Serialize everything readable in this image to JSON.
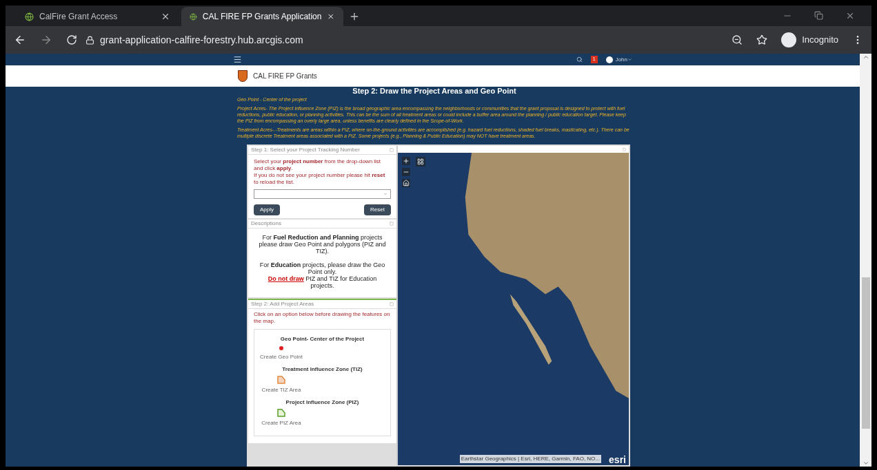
{
  "browser": {
    "tabs": [
      {
        "title": "CalFire Grant Access",
        "selected": false
      },
      {
        "title": "CAL FIRE FP Grants Application",
        "selected": true
      }
    ],
    "url": "grant-application-calfire-forestry.hub.arcgis.com",
    "profile": "Incognito"
  },
  "navbar": {
    "notification_count": "1",
    "user": "John"
  },
  "site_header": {
    "title": "CAL FIRE FP Grants"
  },
  "page_title": "Step 2: Draw the Project Areas and Geo Point",
  "instructions": [
    "Geo Point - Center of the project",
    "Project Acres- The Project influence Zone (PIZ) is the broad geographic area encompassing the neighborhoods or communities that the grant proposal is designed to protect with fuel reductions, public education, or planning activities. This can be the sum of all treatment areas or could include a buffer area around the planning / public education target. Please keep the PIZ from encompassing an overly large area, unless benefits are clearly defined in the Scope-of-Work.",
    "Treatment Acres-.-Treatments are areas within a PIZ, where on-the-ground activities are accomplished (e.g. hazard fuel reductions, shaded fuel breaks, masticating, etc.). There can be multiple discrete Treatment areas associated with a PIZ. Some projects (e.g., Planning & Public Education) may NOT have treatment areas."
  ],
  "step1": {
    "title": "Step 1: Select your Project Tracking Number",
    "text": "Select your **project number** from the drop-down list and click **apply**.",
    "hint": "If you do not see your project number please hit **reset** to reload the list.",
    "buttons": [
      "Apply",
      "Reset"
    ]
  },
  "descriptions": {
    "title": "Descriptions",
    "paragraphs": [
      "For **Fuel Reduction and Planning** projects please draw Geo Point and polygons (PIZ and TIZ).",
      "For **Education** projects, please draw the Geo Point only."
    ],
    "warning_link": "Do not draw",
    "warning_rest": "PIZ and TIZ for Education projects."
  },
  "step2": {
    "title": "Step 2: Add Project Areas",
    "text": "Click on an option below before drawing the features on the map.",
    "options": [
      {
        "kind": "point",
        "heading": "Geo Point- Center of the Project",
        "label": "Create Geo Point"
      },
      {
        "kind": "tiz",
        "heading": "Treatment Influence Zone (TIZ)",
        "label": "Create TIZ Area"
      },
      {
        "kind": "piz",
        "heading": "Project Influence Zone (PIZ)",
        "label": "Create PIZ Area"
      }
    ]
  },
  "map": {
    "attribution": "Earthstar Geographics | Esri, HERE, Garmin, FAO, NO...",
    "logo": "esri"
  }
}
